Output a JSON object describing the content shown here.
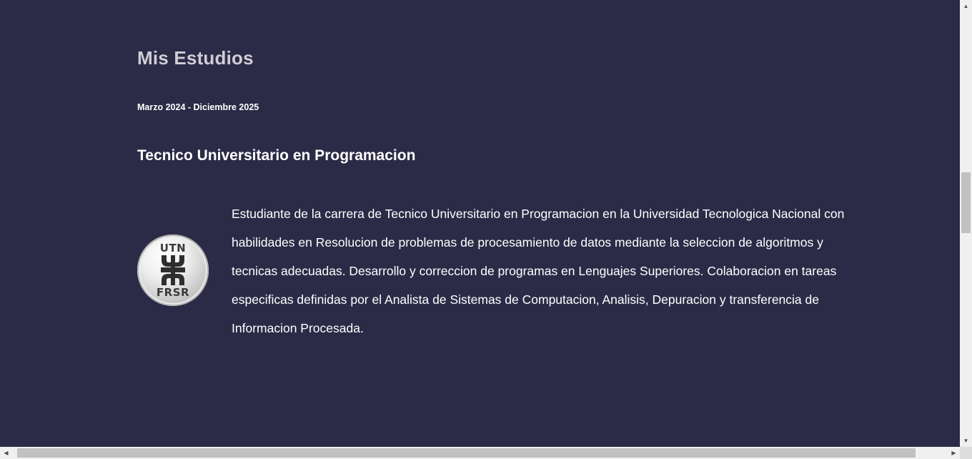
{
  "section": {
    "title": "Mis Estudios"
  },
  "education": {
    "dates": "Marzo 2024 - Diciembre 2025",
    "degree": "Tecnico Universitario en Programacion",
    "logo": {
      "top_text": "UTN",
      "bottom_text": "FRSR"
    },
    "description": "Estudiante de la carrera de Tecnico Universitario en Programacion en la Universidad Tecnologica Nacional con habilidades en Resolucion de problemas de procesamiento de datos mediante la seleccion de algoritmos y tecnicas adecuadas. Desarrollo y correccion de programas en Lenguajes Superiores. Colaboracion en tareas especificas definidas por el Analista de Sistemas de Computacion, Analisis, Depuracion y transferencia de Informacion Procesada."
  },
  "icons": {
    "scroll_up": "triangle-up-icon",
    "scroll_down": "triangle-down-icon",
    "scroll_left": "triangle-left-icon",
    "scroll_right": "triangle-right-icon"
  },
  "colors": {
    "background": "#2c2b47",
    "title": "#d0cdd6",
    "text": "#ffffff"
  }
}
